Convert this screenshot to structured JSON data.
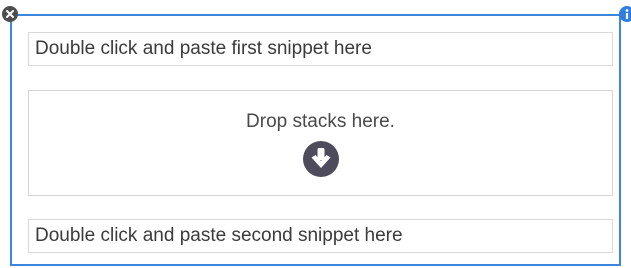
{
  "snippets": {
    "first_placeholder": "Double click and paste first snippet here",
    "second_placeholder": "Double click and paste second snippet here"
  },
  "drop_zone": {
    "label": "Drop stacks here.",
    "icon": "arrow-down-circle-icon"
  },
  "controls": {
    "close_icon": "close-icon",
    "info_icon": "info-icon"
  },
  "colors": {
    "frame_border": "#3d86dd",
    "close_button": "#4d4d4d",
    "info_button": "#2f7fe0",
    "drop_icon": "#4d4b5c"
  }
}
